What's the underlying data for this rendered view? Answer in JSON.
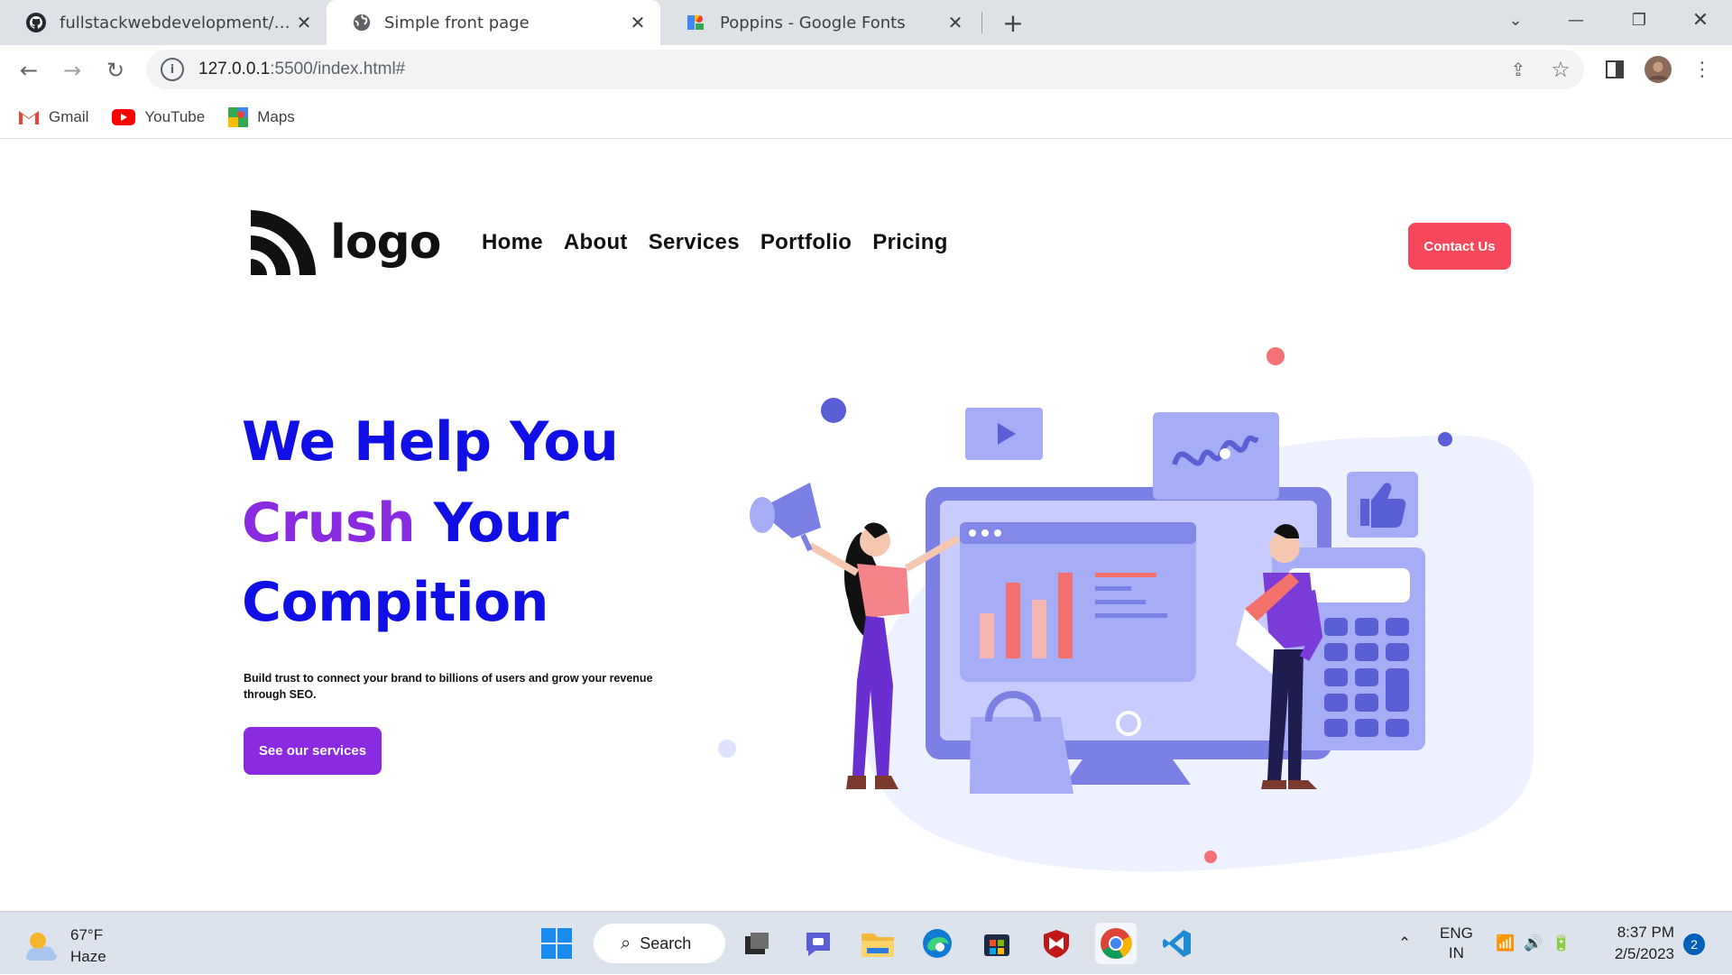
{
  "browser": {
    "tabs": [
      {
        "title": "fullstackwebdevelopment/style.css",
        "icon": "github-icon"
      },
      {
        "title": "Simple front page",
        "icon": "globe-icon"
      },
      {
        "title": "Poppins - Google Fonts",
        "icon": "google-fonts-icon"
      }
    ],
    "url_host": "127.0.0.1",
    "url_rest": ":5500/index.html#",
    "bookmarks": [
      {
        "label": "Gmail",
        "icon": "gmail-icon"
      },
      {
        "label": "YouTube",
        "icon": "youtube-icon"
      },
      {
        "label": "Maps",
        "icon": "maps-icon"
      }
    ]
  },
  "site": {
    "logo_text": "logo",
    "nav": [
      "Home",
      "About",
      "Services",
      "Portfolio",
      "Pricing"
    ],
    "contact_label": "Contact Us",
    "hero": {
      "line1": "We Help You",
      "line2_a": "Crush",
      "line2_b": " Your",
      "line3": "Compition",
      "subtitle": "Build trust to connect your brand to billions of users and grow your revenue through SEO.",
      "cta_label": "See our services"
    },
    "colors": {
      "primary_blue": "#1010e6",
      "purple": "#8a2be2",
      "contact_red": "#f6485a"
    }
  },
  "taskbar": {
    "weather_temp": "67°F",
    "weather_desc": "Haze",
    "search_label": "Search",
    "lang_top": "ENG",
    "lang_bottom": "IN",
    "time": "8:37 PM",
    "date": "2/5/2023",
    "notifications": "2"
  }
}
